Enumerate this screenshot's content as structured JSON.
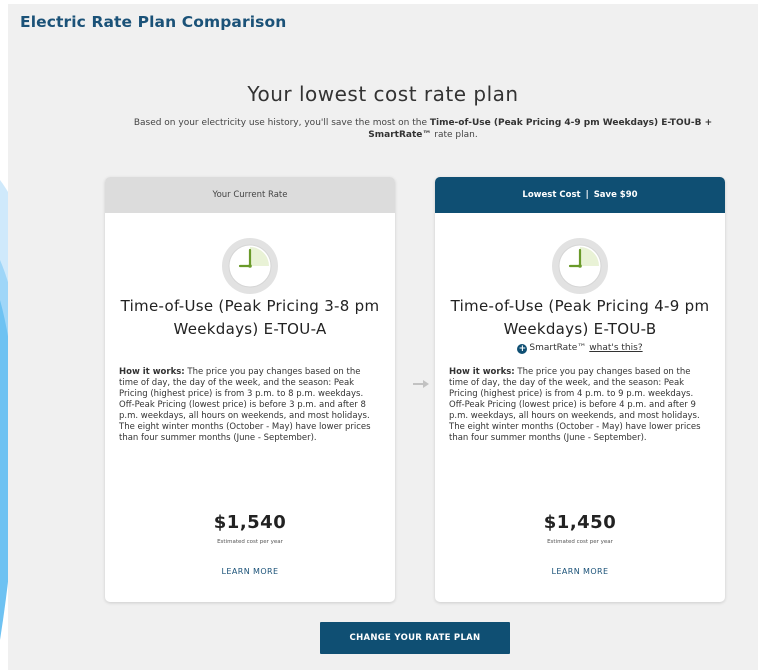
{
  "app": {
    "title": "Electric Rate Plan Comparison"
  },
  "summary": {
    "headline": "Your lowest cost rate plan",
    "sub_prefix": "Based on your electricity use history, you'll save the most on the ",
    "sub_plan": "Time-of-Use (Peak Pricing 4-9 pm Weekdays) E-TOU-B + SmartRate™",
    "sub_suffix": " rate plan."
  },
  "current_plan": {
    "header": "Your Current Rate",
    "name": "Time-of-Use (Peak Pricing 3-8 pm Weekdays) E-TOU-A",
    "how_label": "How it works:",
    "how_text": " The price you pay changes based on the time of day, the day of the week, and the season: Peak Pricing (highest price) is from 3 p.m. to 8 p.m. weekdays.",
    "offpeak_text": "Off-Peak Pricing (lowest price) is before 3 p.m. and after 8 p.m. weekdays, all hours on weekends, and most holidays.",
    "winter_text": "The eight winter months (October - May) have lower prices than four summer months (June - September).",
    "price": "$1,540",
    "price_label": "Estimated cost per year",
    "learn_more": "LEARN MORE"
  },
  "recommended_plan": {
    "header_left": "Lowest Cost",
    "header_sep": "|",
    "header_right": "Save $90",
    "name": "Time-of-Use (Peak Pricing 4-9 pm Weekdays) E-TOU-B",
    "smartrate_label": "SmartRate™",
    "smartrate_link": "what's this?",
    "how_label": "How it works:",
    "how_text": " The price you pay changes based on the time of day, the day of the week, and the season: Peak Pricing (highest price) is from 4 p.m. to 9 p.m. weekdays.",
    "offpeak_text": "Off-Peak Pricing (lowest price) is before 4 p.m. and after 9 p.m. weekdays, all hours on weekends, and most holidays.",
    "winter_text": "The eight winter months (October - May) have lower prices than four summer months (June - September).",
    "price": "$1,450",
    "price_label": "Estimated cost per year",
    "learn_more": "LEARN MORE"
  },
  "cta": {
    "label": "CHANGE YOUR RATE PLAN"
  },
  "colors": {
    "brand": "#0f4f73",
    "title": "#1b5278",
    "panel": "#f0f0f0",
    "current_header": "#dcdcdc"
  },
  "icons": {
    "clock": "clock-icon",
    "arrow": "arrow-right-icon",
    "plus": "plus-circle-icon"
  }
}
